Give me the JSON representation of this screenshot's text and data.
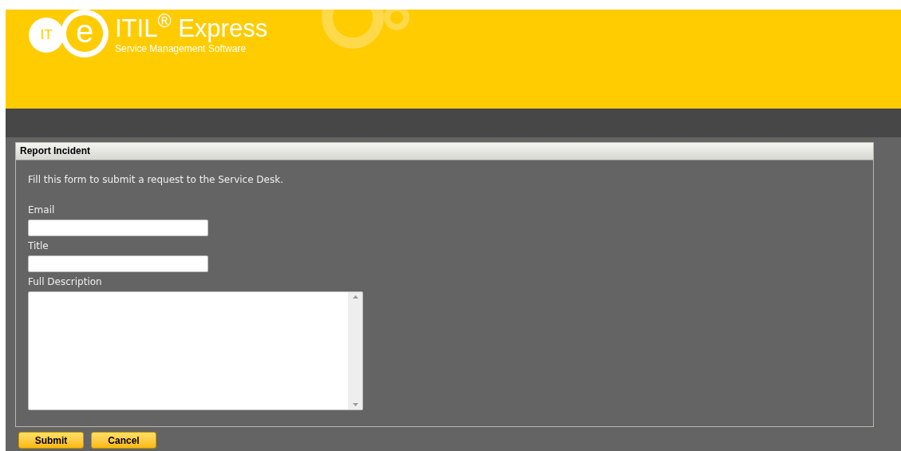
{
  "logo": {
    "mark_left": "IT",
    "mark_right": "e",
    "title": "ITIL$^{®}$ Express",
    "subtitle": "Service Management Software"
  },
  "panel": {
    "title": "Report Incident",
    "intro": "Fill this form to submit a request to the Service Desk.",
    "fields": [
      {
        "label": "Email",
        "kind": "input"
      },
      {
        "label": "Title",
        "kind": "input"
      },
      {
        "label": "Full Description",
        "kind": "textarea"
      }
    ]
  },
  "buttons": [
    "Submit",
    "Cancel"
  ]
}
